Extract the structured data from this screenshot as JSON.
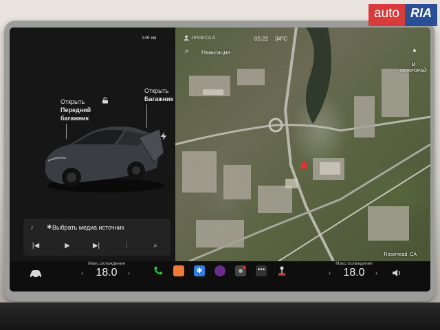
{
  "watermark": {
    "auto": "auto",
    "ria": "RIA"
  },
  "status_bar": {
    "range": "146 км",
    "user": "JESSICA A",
    "time": "05:22",
    "temperature": "34°C"
  },
  "car_panel": {
    "front_trunk": {
      "action": "Открыть",
      "line1": "Передний",
      "line2": "багажник"
    },
    "rear_trunk": {
      "action": "Открыть",
      "line1": "Багажник"
    }
  },
  "media": {
    "source_prompt": "Выбрать медиа источник",
    "controls": [
      "prev",
      "play",
      "next",
      "equalizer",
      "search"
    ]
  },
  "map": {
    "search_label": "Навигация",
    "area_label_line1": "М",
    "area_label_line2": "МИКРОРАЙ",
    "location": "Rosemead, CA"
  },
  "dock": {
    "climate_left": {
      "label": "Макс.охлаждение",
      "value": "18.0"
    },
    "climate_right": {
      "label": "Макс.охлаждение",
      "value": "18.0"
    },
    "apps": [
      {
        "name": "phone-icon",
        "color": "#2ecc40"
      },
      {
        "name": "podcast-icon",
        "color": "#f07838"
      },
      {
        "name": "bluetooth-icon",
        "color": "#2f7de1"
      },
      {
        "name": "camera-icon",
        "color": "#6a2e8a"
      },
      {
        "name": "dashcam-icon",
        "color": "#444444"
      },
      {
        "name": "more-icon",
        "color": "#333333"
      },
      {
        "name": "joystick-icon",
        "color": "#b53a2a"
      }
    ]
  }
}
